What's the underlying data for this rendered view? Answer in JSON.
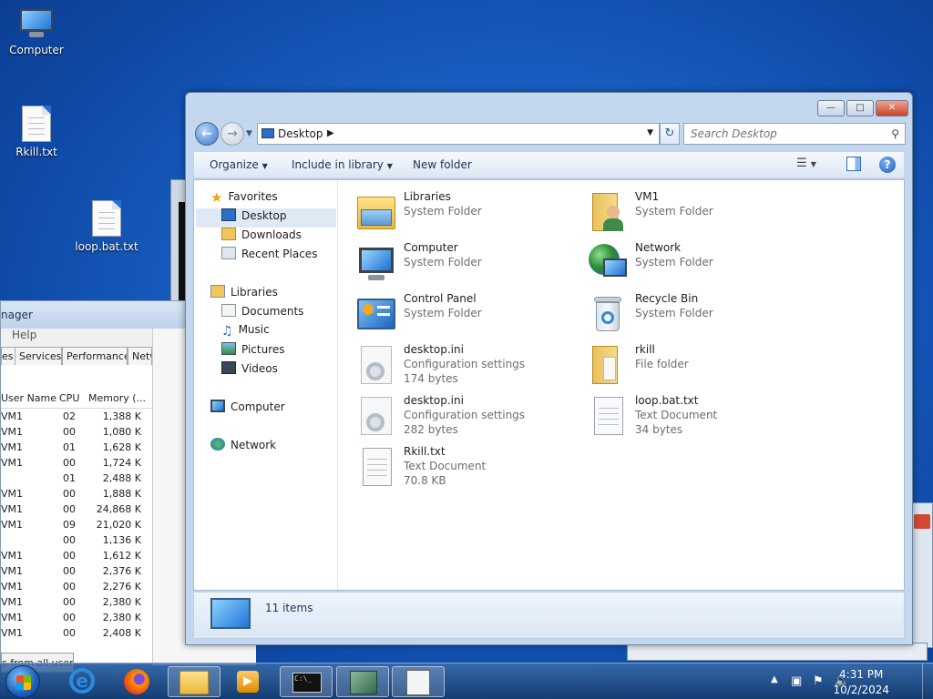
{
  "desktop": {
    "icons": [
      {
        "label": "Computer",
        "icon": "computer-icon"
      },
      {
        "label": "Rkill.txt",
        "icon": "text-file-icon"
      },
      {
        "label": "loop.bat.txt",
        "icon": "text-file-icon"
      }
    ]
  },
  "task_manager": {
    "title_partial": "nager",
    "menu_help": "Help",
    "tabs": [
      "es",
      "Services",
      "Performance",
      "Netw"
    ],
    "columns": [
      "User Name",
      "CPU",
      "Memory (..."
    ],
    "rows": [
      {
        "user": "VM1",
        "cpu": "02",
        "mem": "1,388 K"
      },
      {
        "user": "VM1",
        "cpu": "00",
        "mem": "1,080 K"
      },
      {
        "user": "VM1",
        "cpu": "01",
        "mem": "1,628 K"
      },
      {
        "user": "VM1",
        "cpu": "00",
        "mem": "1,724 K"
      },
      {
        "user": "",
        "cpu": "01",
        "mem": "2,488 K"
      },
      {
        "user": "VM1",
        "cpu": "00",
        "mem": "1,888 K"
      },
      {
        "user": "VM1",
        "cpu": "00",
        "mem": "24,868 K"
      },
      {
        "user": "VM1",
        "cpu": "09",
        "mem": "21,020 K"
      },
      {
        "user": "",
        "cpu": "00",
        "mem": "1,136 K"
      },
      {
        "user": "VM1",
        "cpu": "00",
        "mem": "1,612 K"
      },
      {
        "user": "VM1",
        "cpu": "00",
        "mem": "2,376 K"
      },
      {
        "user": "VM1",
        "cpu": "00",
        "mem": "2,276 K"
      },
      {
        "user": "VM1",
        "cpu": "00",
        "mem": "2,380 K"
      },
      {
        "user": "VM1",
        "cpu": "00",
        "mem": "2,380 K"
      },
      {
        "user": "VM1",
        "cpu": "00",
        "mem": "2,408 K"
      }
    ],
    "show_all_label": "s from all users"
  },
  "explorer": {
    "address": "Desktop",
    "search_placeholder": "Search Desktop",
    "toolbar": {
      "organize": "Organize",
      "include_in_library": "Include in library",
      "new_folder": "New folder"
    },
    "nav": {
      "favorites": "Favorites",
      "desktop": "Desktop",
      "downloads": "Downloads",
      "recent_places": "Recent Places",
      "libraries": "Libraries",
      "documents": "Documents",
      "music": "Music",
      "pictures": "Pictures",
      "videos": "Videos",
      "computer": "Computer",
      "network": "Network"
    },
    "items": [
      {
        "name": "Libraries",
        "line1": "System Folder",
        "line2": "",
        "icon": "libraries-folder-icon"
      },
      {
        "name": "VM1",
        "line1": "System Folder",
        "line2": "",
        "icon": "user-folder-icon"
      },
      {
        "name": "Computer",
        "line1": "System Folder",
        "line2": "",
        "icon": "computer-icon"
      },
      {
        "name": "Network",
        "line1": "System Folder",
        "line2": "",
        "icon": "network-icon"
      },
      {
        "name": "Control Panel",
        "line1": "System Folder",
        "line2": "",
        "icon": "control-panel-icon"
      },
      {
        "name": "Recycle Bin",
        "line1": "System Folder",
        "line2": "",
        "icon": "recycle-bin-icon"
      },
      {
        "name": "desktop.ini",
        "line1": "Configuration settings",
        "line2": "174 bytes",
        "icon": "settings-file-icon"
      },
      {
        "name": "rkill",
        "line1": "File folder",
        "line2": "",
        "icon": "folder-icon"
      },
      {
        "name": "desktop.ini",
        "line1": "Configuration settings",
        "line2": "282 bytes",
        "icon": "settings-file-icon"
      },
      {
        "name": "loop.bat.txt",
        "line1": "Text Document",
        "line2": "34 bytes",
        "icon": "text-file-icon"
      },
      {
        "name": "Rkill.txt",
        "line1": "Text Document",
        "line2": "70.8 KB",
        "icon": "text-file-icon"
      }
    ],
    "status": "11 items"
  },
  "taskbar": {
    "time": "4:31 PM",
    "date": "10/2/2024"
  }
}
